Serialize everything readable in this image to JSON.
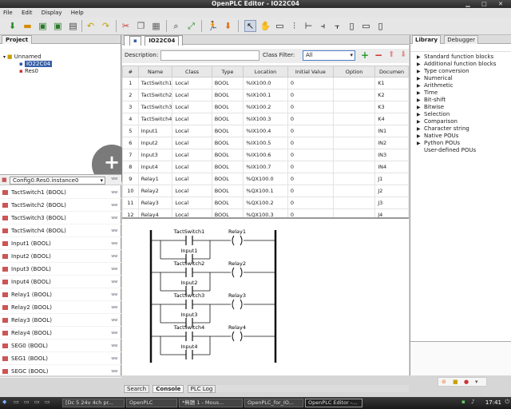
{
  "window": {
    "title": "OpenPLC Editor - IO22C04"
  },
  "menu": [
    "File",
    "Edit",
    "Display",
    "Help"
  ],
  "project": {
    "tab": "Project",
    "tree": [
      "Unnamed",
      "IO22C04",
      "Res0"
    ],
    "instance_select": "Config0.Res0.instance0",
    "variables": [
      "TactSwitch1 (BOOL)",
      "TactSwitch2 (BOOL)",
      "TactSwitch3 (BOOL)",
      "TactSwitch4 (BOOL)",
      "Input1 (BOOL)",
      "Input2 (BOOL)",
      "Input3 (BOOL)",
      "Input4 (BOOL)",
      "Relay1 (BOOL)",
      "Relay2 (BOOL)",
      "Relay3 (BOOL)",
      "Relay4 (BOOL)",
      "SEG0 (BOOL)",
      "SEG1 (BOOL)",
      "SEGC (BOOL)"
    ]
  },
  "editor": {
    "tab": "IO22C04",
    "description_label": "Description:",
    "class_filter_label": "Class Filter:",
    "class_filter_value": "All",
    "columns": [
      "#",
      "Name",
      "Class",
      "Type",
      "Location",
      "Initial Value",
      "Option",
      "Documen"
    ],
    "rows": [
      [
        "1",
        "TactSwitch1",
        "Local",
        "BOOL",
        "%IX100.0",
        "0",
        "",
        "K1"
      ],
      [
        "2",
        "TactSwitch2",
        "Local",
        "BOOL",
        "%IX100.1",
        "0",
        "",
        "K2"
      ],
      [
        "3",
        "TactSwitch3",
        "Local",
        "BOOL",
        "%IX100.2",
        "0",
        "",
        "K3"
      ],
      [
        "4",
        "TactSwitch4",
        "Local",
        "BOOL",
        "%IX100.3",
        "0",
        "",
        "K4"
      ],
      [
        "5",
        "Input1",
        "Local",
        "BOOL",
        "%IX100.4",
        "0",
        "",
        "IN1"
      ],
      [
        "6",
        "Input2",
        "Local",
        "BOOL",
        "%IX100.5",
        "0",
        "",
        "IN2"
      ],
      [
        "7",
        "Input3",
        "Local",
        "BOOL",
        "%IX100.6",
        "0",
        "",
        "IN3"
      ],
      [
        "8",
        "Input4",
        "Local",
        "BOOL",
        "%IX100.7",
        "0",
        "",
        "IN4"
      ],
      [
        "9",
        "Relay1",
        "Local",
        "BOOL",
        "%QX100.0",
        "0",
        "",
        "J1"
      ],
      [
        "10",
        "Relay2",
        "Local",
        "BOOL",
        "%QX100.1",
        "0",
        "",
        "J2"
      ],
      [
        "11",
        "Relay3",
        "Local",
        "BOOL",
        "%QX100.2",
        "0",
        "",
        "J3"
      ],
      [
        "12",
        "Relay4",
        "Local",
        "BOOL",
        "%QX100.3",
        "0",
        "",
        "J4"
      ]
    ]
  },
  "ladder": {
    "rungs": [
      {
        "contact_top": "TactSwitch1",
        "contact_bottom": "Input1",
        "coil": "Relay1"
      },
      {
        "contact_top": "TactSwitch2",
        "contact_bottom": "Input2",
        "coil": "Relay2"
      },
      {
        "contact_top": "TactSwitch3",
        "contact_bottom": "Input3",
        "coil": "Relay3"
      },
      {
        "contact_top": "TactSwitch4",
        "contact_bottom": "Input4",
        "coil": "Relay4"
      }
    ]
  },
  "library": {
    "tabs": [
      "Library",
      "Debugger"
    ],
    "items": [
      "Standard function blocks",
      "Additional function blocks",
      "Type conversion",
      "Numerical",
      "Arithmetic",
      "Time",
      "Bit-shift",
      "Bitwise",
      "Selection",
      "Comparison",
      "Character string",
      "Native POUs",
      "Python POUs",
      "User-defined POUs"
    ]
  },
  "bottom_tabs": [
    "Search",
    "Console",
    "PLC Log"
  ],
  "taskbar": {
    "tasks": [
      "[Dc 5 24v 4ch pr...",
      "OpenPLC",
      "*無題 1 - Mous...",
      "OpenPLC_for_IO...",
      "OpenPLC Editor -..."
    ],
    "clock": "17:41"
  }
}
